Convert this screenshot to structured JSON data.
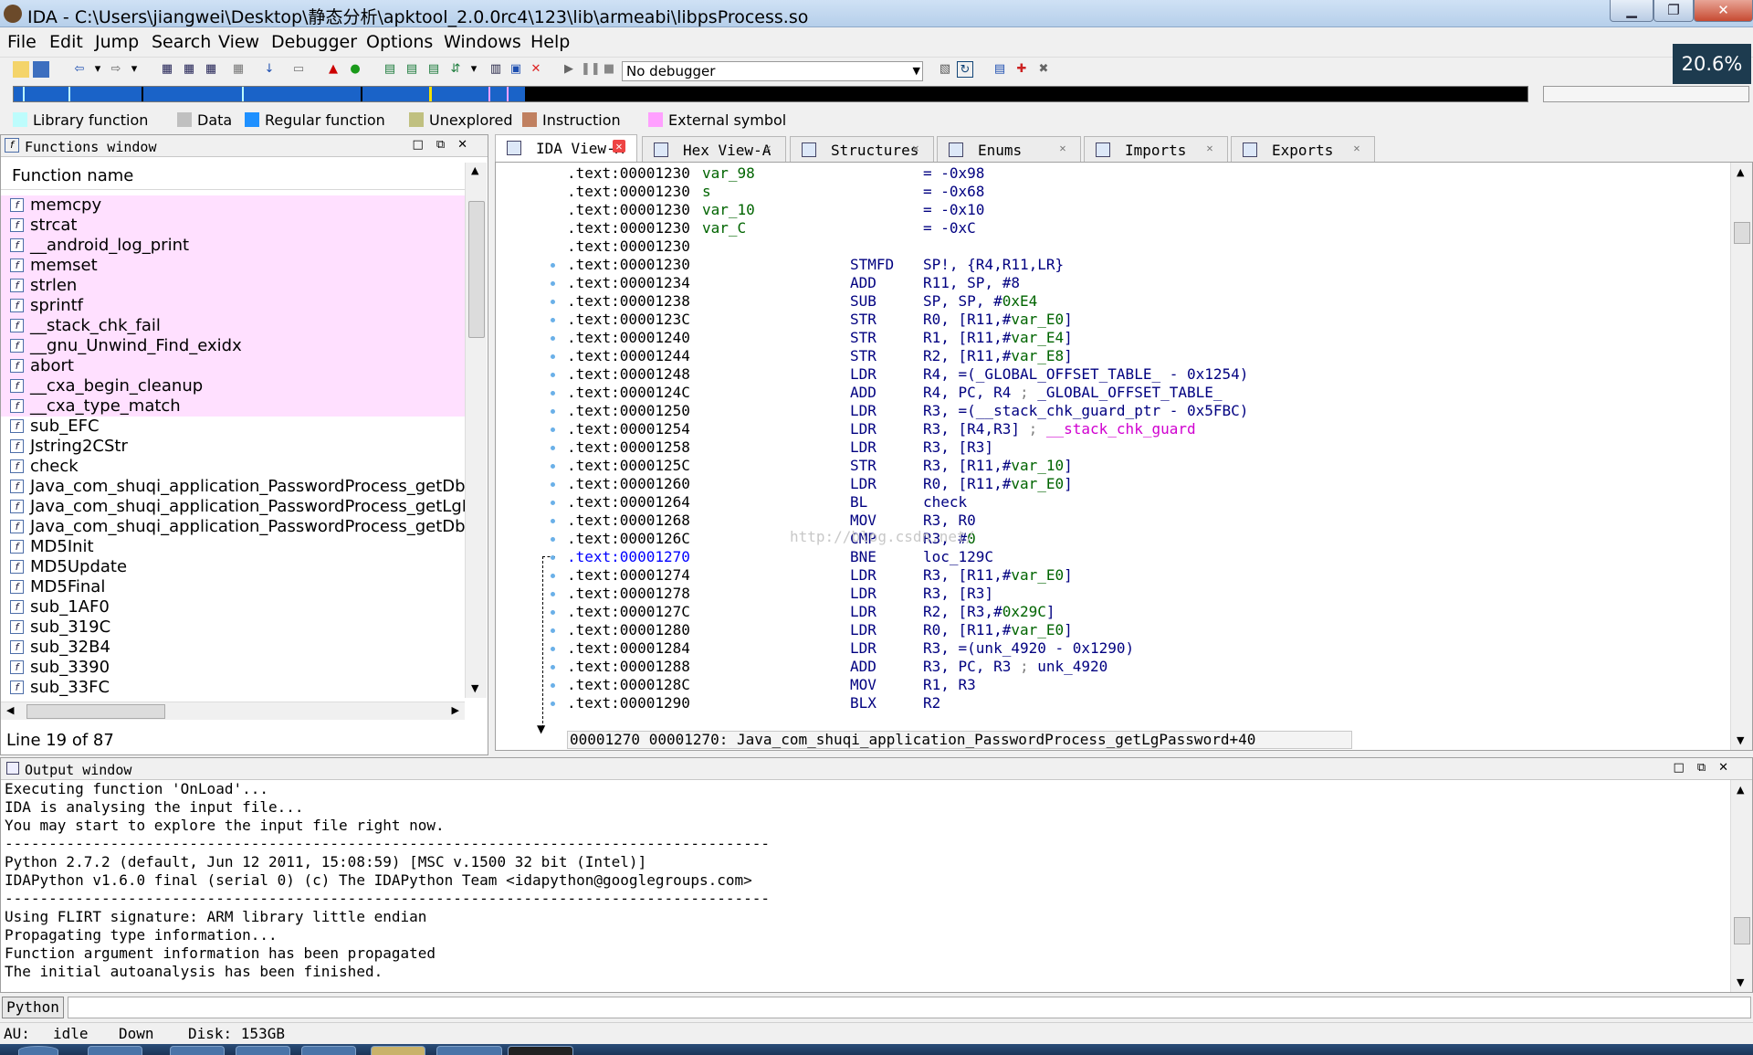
{
  "window": {
    "title": "IDA - C:\\Users\\jiangwei\\Desktop\\静态分析\\apktool_2.0.0rc4\\123\\lib\\armeabi\\libpsProcess.so",
    "minimize": "▁",
    "maximize": "❐",
    "close": "✕",
    "zoom_badge": "20.6%"
  },
  "menu": [
    "File",
    "Edit",
    "Jump",
    "Search",
    "View",
    "Debugger",
    "Options",
    "Windows",
    "Help"
  ],
  "toolbar": {
    "debugger_select": "No debugger"
  },
  "legend": [
    {
      "label": "Library function",
      "color": "#bdfcfc"
    },
    {
      "label": "Data",
      "color": "#c0c0c0"
    },
    {
      "label": "Regular function",
      "color": "#1e90ff"
    },
    {
      "label": "Unexplored",
      "color": "#c0c080"
    },
    {
      "label": "Instruction",
      "color": "#c08060"
    },
    {
      "label": "External symbol",
      "color": "#ffa0ff"
    }
  ],
  "functions_window": {
    "title": "Functions window",
    "column_header": "Function name",
    "items": [
      {
        "name": "memcpy",
        "library": true
      },
      {
        "name": "strcat",
        "library": true
      },
      {
        "name": "__android_log_print",
        "library": true
      },
      {
        "name": "memset",
        "library": true
      },
      {
        "name": "strlen",
        "library": true
      },
      {
        "name": "sprintf",
        "library": true
      },
      {
        "name": "__stack_chk_fail",
        "library": true
      },
      {
        "name": "__gnu_Unwind_Find_exidx",
        "library": true
      },
      {
        "name": "abort",
        "library": true
      },
      {
        "name": "__cxa_begin_cleanup",
        "library": true
      },
      {
        "name": "__cxa_type_match",
        "library": true
      },
      {
        "name": "sub_EFC",
        "library": false
      },
      {
        "name": "Jstring2CStr",
        "library": false
      },
      {
        "name": "check",
        "library": false
      },
      {
        "name": "Java_com_shuqi_application_PasswordProcess_getDbAE",
        "library": false
      },
      {
        "name": "Java_com_shuqi_application_PasswordProcess_getLgPas",
        "library": false
      },
      {
        "name": "Java_com_shuqi_application_PasswordProcess_getDbPa",
        "library": false
      },
      {
        "name": "MD5Init",
        "library": false
      },
      {
        "name": "MD5Update",
        "library": false
      },
      {
        "name": "MD5Final",
        "library": false
      },
      {
        "name": "sub_1AF0",
        "library": false
      },
      {
        "name": "sub_319C",
        "library": false
      },
      {
        "name": "sub_32B4",
        "library": false
      },
      {
        "name": "sub_3390",
        "library": false
      },
      {
        "name": "sub_33FC",
        "library": false
      }
    ],
    "status": "Line 19 of 87"
  },
  "tabs": [
    {
      "label": "IDA View-A",
      "icon": "ida-view-icon",
      "active": true
    },
    {
      "label": "Hex View-A",
      "icon": "hex-view-icon",
      "active": false
    },
    {
      "label": "Structures",
      "icon": "structures-icon",
      "active": false
    },
    {
      "label": "Enums",
      "icon": "enums-icon",
      "active": false
    },
    {
      "label": "Imports",
      "icon": "imports-icon",
      "active": false
    },
    {
      "label": "Exports",
      "icon": "exports-icon",
      "active": false
    }
  ],
  "disasm": {
    "lines": [
      {
        "addr": ".text:00001230",
        "label": "var_98",
        "mn": "",
        "op": [
          {
            "t": "= -0x98",
            "c": "plain"
          }
        ],
        "dot": false
      },
      {
        "addr": ".text:00001230",
        "label": "s",
        "mn": "",
        "op": [
          {
            "t": "= -0x68",
            "c": "plain"
          }
        ],
        "dot": false
      },
      {
        "addr": ".text:00001230",
        "label": "var_10",
        "mn": "",
        "op": [
          {
            "t": "= -0x10",
            "c": "plain"
          }
        ],
        "dot": false
      },
      {
        "addr": ".text:00001230",
        "label": "var_C",
        "mn": "",
        "op": [
          {
            "t": "= -0xC",
            "c": "plain"
          }
        ],
        "dot": false
      },
      {
        "addr": ".text:00001230",
        "label": "",
        "mn": "",
        "op": [],
        "dot": false
      },
      {
        "addr": ".text:00001230",
        "label": "",
        "mn": "STMFD",
        "op": [
          {
            "t": "SP!, {R4,R11,LR}",
            "c": "plain"
          }
        ],
        "dot": true
      },
      {
        "addr": ".text:00001234",
        "label": "",
        "mn": "ADD",
        "op": [
          {
            "t": "R11, SP, #8",
            "c": "plain"
          }
        ],
        "dot": true
      },
      {
        "addr": ".text:00001238",
        "label": "",
        "mn": "SUB",
        "op": [
          {
            "t": "SP, SP, #",
            "c": "plain"
          },
          {
            "t": "0xE4",
            "c": "ref"
          }
        ],
        "dot": true
      },
      {
        "addr": ".text:0000123C",
        "label": "",
        "mn": "STR",
        "op": [
          {
            "t": "R0, [R11,#",
            "c": "plain"
          },
          {
            "t": "var_E0",
            "c": "ref"
          },
          {
            "t": "]",
            "c": "plain"
          }
        ],
        "dot": true
      },
      {
        "addr": ".text:00001240",
        "label": "",
        "mn": "STR",
        "op": [
          {
            "t": "R1, [R11,#",
            "c": "plain"
          },
          {
            "t": "var_E4",
            "c": "ref"
          },
          {
            "t": "]",
            "c": "plain"
          }
        ],
        "dot": true
      },
      {
        "addr": ".text:00001244",
        "label": "",
        "mn": "STR",
        "op": [
          {
            "t": "R2, [R11,#",
            "c": "plain"
          },
          {
            "t": "var_E8",
            "c": "ref"
          },
          {
            "t": "]",
            "c": "plain"
          }
        ],
        "dot": true
      },
      {
        "addr": ".text:00001248",
        "label": "",
        "mn": "LDR",
        "op": [
          {
            "t": "R4, =(_GLOBAL_OFFSET_TABLE_ - 0x1254)",
            "c": "plain"
          }
        ],
        "dot": true
      },
      {
        "addr": ".text:0000124C",
        "label": "",
        "mn": "ADD",
        "op": [
          {
            "t": "R4, PC, R4 ",
            "c": "plain"
          },
          {
            "t": "; ",
            "c": "cmt"
          },
          {
            "t": "_GLOBAL_OFFSET_TABLE_",
            "c": "plain"
          }
        ],
        "dot": true
      },
      {
        "addr": ".text:00001250",
        "label": "",
        "mn": "LDR",
        "op": [
          {
            "t": "R3, =(__stack_chk_guard_ptr - 0x5FBC)",
            "c": "plain"
          }
        ],
        "dot": true
      },
      {
        "addr": ".text:00001254",
        "label": "",
        "mn": "LDR",
        "op": [
          {
            "t": "R3, [R4,R3] ",
            "c": "plain"
          },
          {
            "t": "; ",
            "c": "cmt"
          },
          {
            "t": "__stack_chk_guard",
            "c": "ext"
          }
        ],
        "dot": true
      },
      {
        "addr": ".text:00001258",
        "label": "",
        "mn": "LDR",
        "op": [
          {
            "t": "R3, [R3]",
            "c": "plain"
          }
        ],
        "dot": true
      },
      {
        "addr": ".text:0000125C",
        "label": "",
        "mn": "STR",
        "op": [
          {
            "t": "R3, [R11,#",
            "c": "plain"
          },
          {
            "t": "var_10",
            "c": "ref"
          },
          {
            "t": "]",
            "c": "plain"
          }
        ],
        "dot": true
      },
      {
        "addr": ".text:00001260",
        "label": "",
        "mn": "LDR",
        "op": [
          {
            "t": "R0, [R11,#",
            "c": "plain"
          },
          {
            "t": "var_E0",
            "c": "ref"
          },
          {
            "t": "]",
            "c": "plain"
          }
        ],
        "dot": true
      },
      {
        "addr": ".text:00001264",
        "label": "",
        "mn": "BL",
        "op": [
          {
            "t": "check",
            "c": "call"
          }
        ],
        "dot": true
      },
      {
        "addr": ".text:00001268",
        "label": "",
        "mn": "MOV",
        "op": [
          {
            "t": "R3, R0",
            "c": "plain"
          }
        ],
        "dot": true
      },
      {
        "addr": ".text:0000126C",
        "label": "",
        "mn": "CMP",
        "op": [
          {
            "t": "R3, #",
            "c": "plain"
          },
          {
            "t": "0",
            "c": "ref"
          }
        ],
        "dot": true
      },
      {
        "addr": ".text:00001270",
        "label": "",
        "mn": "BNE",
        "op": [
          {
            "t": "loc_129C",
            "c": "plain"
          }
        ],
        "dot": true,
        "current": true
      },
      {
        "addr": ".text:00001274",
        "label": "",
        "mn": "LDR",
        "op": [
          {
            "t": "R3, [R11,#",
            "c": "plain"
          },
          {
            "t": "var_E0",
            "c": "ref"
          },
          {
            "t": "]",
            "c": "plain"
          }
        ],
        "dot": true
      },
      {
        "addr": ".text:00001278",
        "label": "",
        "mn": "LDR",
        "op": [
          {
            "t": "R3, [R3]",
            "c": "plain"
          }
        ],
        "dot": true
      },
      {
        "addr": ".text:0000127C",
        "label": "",
        "mn": "LDR",
        "op": [
          {
            "t": "R2, [R3,#",
            "c": "plain"
          },
          {
            "t": "0x29C",
            "c": "ref"
          },
          {
            "t": "]",
            "c": "plain"
          }
        ],
        "dot": true
      },
      {
        "addr": ".text:00001280",
        "label": "",
        "mn": "LDR",
        "op": [
          {
            "t": "R0, [R11,#",
            "c": "plain"
          },
          {
            "t": "var_E0",
            "c": "ref"
          },
          {
            "t": "]",
            "c": "plain"
          }
        ],
        "dot": true
      },
      {
        "addr": ".text:00001284",
        "label": "",
        "mn": "LDR",
        "op": [
          {
            "t": "R3, =(unk_4920 - 0x1290)",
            "c": "plain"
          }
        ],
        "dot": true
      },
      {
        "addr": ".text:00001288",
        "label": "",
        "mn": "ADD",
        "op": [
          {
            "t": "R3, PC, R3 ",
            "c": "plain"
          },
          {
            "t": "; ",
            "c": "cmt"
          },
          {
            "t": "unk_4920",
            "c": "plain"
          }
        ],
        "dot": true
      },
      {
        "addr": ".text:0000128C",
        "label": "",
        "mn": "MOV",
        "op": [
          {
            "t": "R1, R3",
            "c": "plain"
          }
        ],
        "dot": true
      },
      {
        "addr": ".text:00001290",
        "label": "",
        "mn": "BLX",
        "op": [
          {
            "t": "R2",
            "c": "plain"
          }
        ],
        "dot": true
      }
    ],
    "sync_text": "00001270 00001270: Java_com_shuqi_application_PasswordProcess_getLgPassword+40",
    "watermark": "http://blog.csdn.net/"
  },
  "output_window": {
    "title": "Output window",
    "lines": [
      "Executing function 'OnLoad'...",
      "IDA is analysing the input file...",
      "You may start to explore the input file right now.",
      "---------------------------------------------------------------------------------------",
      "Python 2.7.2 (default, Jun 12 2011, 15:08:59) [MSC v.1500 32 bit (Intel)]",
      "IDAPython v1.6.0 final (serial 0) (c) The IDAPython Team <idapython@googlegroups.com>",
      "---------------------------------------------------------------------------------------",
      "Using FLIRT signature: ARM library little endian",
      "Propagating type information...",
      "Function argument information has been propagated",
      "The initial autoanalysis has been finished."
    ]
  },
  "python_button": "Python",
  "status": {
    "au_label": "AU:",
    "au_value": "idle",
    "direction": "Down",
    "disk": "Disk: 153GB"
  }
}
